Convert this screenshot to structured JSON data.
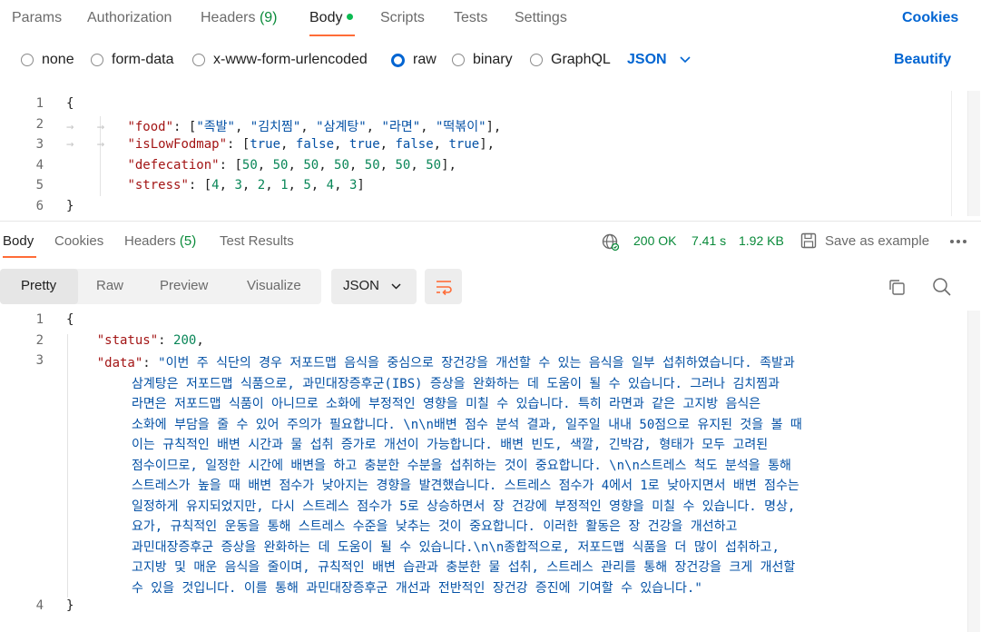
{
  "request_tabs": {
    "params": "Params",
    "authorization": "Authorization",
    "headers": "Headers",
    "headers_count": "(9)",
    "body": "Body",
    "scripts": "Scripts",
    "tests": "Tests",
    "settings": "Settings",
    "cookies": "Cookies"
  },
  "body_types": {
    "none": "none",
    "form_data": "form-data",
    "urlencoded": "x-www-form-urlencoded",
    "raw": "raw",
    "binary": "binary",
    "graphql": "GraphQL",
    "format": "JSON",
    "beautify": "Beautify",
    "selected": "raw"
  },
  "request_body": {
    "line_numbers": [
      "1",
      "2",
      "3",
      "4",
      "5",
      "6"
    ],
    "food_key": "\"food\"",
    "food_values": [
      "\"족발\"",
      "\"김치찜\"",
      "\"삼계탕\"",
      "\"라면\"",
      "\"떡볶이\""
    ],
    "lowfodmap_key": "\"isLowFodmap\"",
    "lowfodmap_values": [
      "true",
      "false",
      "true",
      "false",
      "true"
    ],
    "defecation_key": "\"defecation\"",
    "defecation_values": [
      "50",
      "50",
      "50",
      "50",
      "50",
      "50",
      "50"
    ],
    "stress_key": "\"stress\"",
    "stress_values": [
      "4",
      "3",
      "2",
      "1",
      "5",
      "4",
      "3"
    ]
  },
  "response_tabs": {
    "body": "Body",
    "cookies": "Cookies",
    "headers": "Headers",
    "headers_count": "(5)",
    "test_results": "Test Results",
    "status": "200 OK",
    "time": "7.41 s",
    "size": "1.92 KB",
    "save_example": "Save as example"
  },
  "view_modes": {
    "pretty": "Pretty",
    "raw": "Raw",
    "preview": "Preview",
    "visualize": "Visualize",
    "format": "JSON"
  },
  "response_body": {
    "line_numbers": [
      "1",
      "2",
      "3",
      "4"
    ],
    "status_key": "\"status\"",
    "status_value": "200",
    "data_key": "\"data\"",
    "data_lines": [
      "\"이번 주 식단의 경우 저포드맵 음식을 중심으로 장건강을 개선할 수 있는 음식을 일부 섭취하였습니다. 족발과",
      "삼계탕은 저포드맵 식품으로, 과민대장증후군(IBS) 증상을 완화하는 데 도움이 될 수 있습니다. 그러나 김치찜과",
      "라면은 저포드맵 식품이 아니므로 소화에 부정적인 영향을 미칠 수 있습니다. 특히 라면과 같은 고지방 음식은",
      "소화에 부담을 줄 수 있어 주의가 필요합니다. \\n\\n배변 점수 분석 결과, 일주일 내내 50점으로 유지된 것을 볼 때",
      "이는 규칙적인 배변 시간과 물 섭취 증가로 개선이 가능합니다. 배변 빈도, 색깔, 긴박감, 형태가 모두 고려된",
      "점수이므로, 일정한 시간에 배변을 하고 충분한 수분을 섭취하는 것이 중요합니다. \\n\\n스트레스 척도 분석을 통해",
      "스트레스가 높을 때 배변 점수가 낮아지는 경향을 발견했습니다. 스트레스 점수가 4에서 1로 낮아지면서 배변 점수는",
      "일정하게 유지되었지만, 다시 스트레스 점수가 5로 상승하면서 장 건강에 부정적인 영향을 미칠 수 있습니다. 명상,",
      "요가, 규칙적인 운동을 통해 스트레스 수준을 낮추는 것이 중요합니다. 이러한 활동은 장 건강을 개선하고",
      "과민대장증후군 증상을 완화하는 데 도움이 될 수 있습니다.\\n\\n종합적으로, 저포드맵 식품을 더 많이 섭취하고,",
      "고지방 및 매운 음식을 줄이며, 규칙적인 배변 습관과 충분한 물 섭취, 스트레스 관리를 통해 장건강을 크게 개선할",
      "수 있을 것입니다. 이를 통해 과민대장증후군 개선과 전반적인 장건강 증진에 기여할 수 있습니다.\""
    ]
  },
  "colors": {
    "accent": "#ff6c37",
    "link": "#0265d2",
    "success": "#0a8a3a"
  }
}
